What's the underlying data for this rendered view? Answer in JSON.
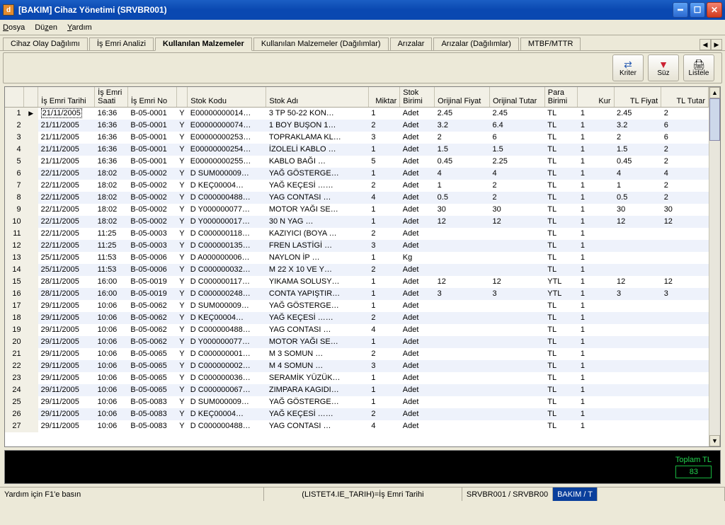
{
  "window": {
    "title": "[BAKIM] Cihaz Yönetimi (SRVBR001)"
  },
  "menu": {
    "items": [
      "Dosya",
      "Düzen",
      "Yardım"
    ]
  },
  "tabs": {
    "items": [
      "Cihaz Olay Dağılımı",
      "İş Emri Analizi",
      "Kullanılan Malzemeler",
      "Kullanılan Malzemeler (Dağılımlar)",
      "Arızalar",
      "Arızalar (Dağılımlar)",
      "MTBF/MTTR"
    ],
    "active": 2
  },
  "toolbar": {
    "kriter": "Kriter",
    "suz": "Süz",
    "listele": "Listele"
  },
  "grid": {
    "headers": [
      "İş Emri Tarihi",
      "İş Emri\nSaati",
      "İş Emri No",
      " ",
      "Stok Kodu",
      "Stok Adı",
      "Miktar",
      "Stok\nBirimi",
      "Orijinal Fiyat",
      "Orijinal Tutar",
      "Para\nBirimi",
      "Kur",
      "TL Fiyat",
      "TL Tutar"
    ],
    "rows": [
      {
        "n": 1,
        "t": "21/11/2005",
        "s": "16:36",
        "e": "B-05-0001",
        "y": "Y",
        "k": "E00000000014…",
        "a": "3 TP 50-22 KON…",
        "m": "1",
        "b": "Adet",
        "of": "2.45",
        "ot": "2.45",
        "pb": "TL",
        "kur": "1",
        "tf": "2.45",
        "tt": "2"
      },
      {
        "n": 2,
        "t": "21/11/2005",
        "s": "16:36",
        "e": "B-05-0001",
        "y": "Y",
        "k": "E00000000074…",
        "a": "1 BOY BUŞON 1…",
        "m": "2",
        "b": "Adet",
        "of": "3.2",
        "ot": "6.4",
        "pb": "TL",
        "kur": "1",
        "tf": "3.2",
        "tt": "6"
      },
      {
        "n": 3,
        "t": "21/11/2005",
        "s": "16:36",
        "e": "B-05-0001",
        "y": "Y",
        "k": "E00000000253…",
        "a": "TOPRAKLAMA KL…",
        "m": "3",
        "b": "Adet",
        "of": "2",
        "ot": "6",
        "pb": "TL",
        "kur": "1",
        "tf": "2",
        "tt": "6"
      },
      {
        "n": 4,
        "t": "21/11/2005",
        "s": "16:36",
        "e": "B-05-0001",
        "y": "Y",
        "k": "E00000000254…",
        "a": "İZOLELİ KABLO  …",
        "m": "1",
        "b": "Adet",
        "of": "1.5",
        "ot": "1.5",
        "pb": "TL",
        "kur": "1",
        "tf": "1.5",
        "tt": "2"
      },
      {
        "n": 5,
        "t": "21/11/2005",
        "s": "16:36",
        "e": "B-05-0001",
        "y": "Y",
        "k": "E00000000255…",
        "a": "KABLO BAĞI   …",
        "m": "5",
        "b": "Adet",
        "of": "0.45",
        "ot": "2.25",
        "pb": "TL",
        "kur": "1",
        "tf": "0.45",
        "tt": "2"
      },
      {
        "n": 6,
        "t": "22/11/2005",
        "s": "18:02",
        "e": "B-05-0002",
        "y": "Y",
        "k": "D SUM000009…",
        "a": "YAĞ GÖSTERGE…",
        "m": "1",
        "b": "Adet",
        "of": "4",
        "ot": "4",
        "pb": "TL",
        "kur": "1",
        "tf": "4",
        "tt": "4"
      },
      {
        "n": 7,
        "t": "22/11/2005",
        "s": "18:02",
        "e": "B-05-0002",
        "y": "Y",
        "k": "D KEÇ00004…",
        "a": "YAĞ KEÇESİ   ……",
        "m": "2",
        "b": "Adet",
        "of": "1",
        "ot": "2",
        "pb": "TL",
        "kur": "1",
        "tf": "1",
        "tt": "2"
      },
      {
        "n": 8,
        "t": "22/11/2005",
        "s": "18:02",
        "e": "B-05-0002",
        "y": "Y",
        "k": "D C000000488…",
        "a": "YAG CONTASI   …",
        "m": "4",
        "b": "Adet",
        "of": "0.5",
        "ot": "2",
        "pb": "TL",
        "kur": "1",
        "tf": "0.5",
        "tt": "2"
      },
      {
        "n": 9,
        "t": "22/11/2005",
        "s": "18:02",
        "e": "B-05-0002",
        "y": "Y",
        "k": "D Y000000077…",
        "a": "MOTOR YAĞI SE…",
        "m": "1",
        "b": "Adet",
        "of": "30",
        "ot": "30",
        "pb": "TL",
        "kur": "1",
        "tf": "30",
        "tt": "30"
      },
      {
        "n": 10,
        "t": "22/11/2005",
        "s": "18:02",
        "e": "B-05-0002",
        "y": "Y",
        "k": "D Y000000017…",
        "a": "30 N YAG      …",
        "m": "1",
        "b": "Adet",
        "of": "12",
        "ot": "12",
        "pb": "TL",
        "kur": "1",
        "tf": "12",
        "tt": "12"
      },
      {
        "n": 11,
        "t": "22/11/2005",
        "s": "11:25",
        "e": "B-05-0003",
        "y": "Y",
        "k": "D C000000118…",
        "a": "KAZIYICI (BOYA …",
        "m": "2",
        "b": "Adet",
        "of": "",
        "ot": "",
        "pb": "TL",
        "kur": "1",
        "tf": "",
        "tt": ""
      },
      {
        "n": 12,
        "t": "22/11/2005",
        "s": "11:25",
        "e": "B-05-0003",
        "y": "Y",
        "k": "D C000000135…",
        "a": "FREN LASTİGİ  …",
        "m": "3",
        "b": "Adet",
        "of": "",
        "ot": "",
        "pb": "TL",
        "kur": "1",
        "tf": "",
        "tt": ""
      },
      {
        "n": 13,
        "t": "25/11/2005",
        "s": "11:53",
        "e": "B-05-0006",
        "y": "Y",
        "k": "D A000000006…",
        "a": "NAYLON İP     …",
        "m": "1",
        "b": "Kg",
        "of": "",
        "ot": "",
        "pb": "TL",
        "kur": "1",
        "tf": "",
        "tt": ""
      },
      {
        "n": 14,
        "t": "25/11/2005",
        "s": "11:53",
        "e": "B-05-0006",
        "y": "Y",
        "k": "D C000000032…",
        "a": "M 22 X 10 VE Y…",
        "m": "2",
        "b": "Adet",
        "of": "",
        "ot": "",
        "pb": "TL",
        "kur": "1",
        "tf": "",
        "tt": ""
      },
      {
        "n": 15,
        "t": "28/11/2005",
        "s": "16:00",
        "e": "B-05-0019",
        "y": "Y",
        "k": "D C000000117…",
        "a": "YIKAMA SOLUSY…",
        "m": "1",
        "b": "Adet",
        "of": "12",
        "ot": "12",
        "pb": "YTL",
        "kur": "1",
        "tf": "12",
        "tt": "12"
      },
      {
        "n": 16,
        "t": "28/11/2005",
        "s": "16:00",
        "e": "B-05-0019",
        "y": "Y",
        "k": "D C000000248…",
        "a": "CONTA YAPIŞTIR…",
        "m": "1",
        "b": "Adet",
        "of": "3",
        "ot": "3",
        "pb": "YTL",
        "kur": "1",
        "tf": "3",
        "tt": "3"
      },
      {
        "n": 17,
        "t": "29/11/2005",
        "s": "10:06",
        "e": "B-05-0062",
        "y": "Y",
        "k": "D SUM000009…",
        "a": "YAĞ GÖSTERGE…",
        "m": "1",
        "b": "Adet",
        "of": "",
        "ot": "",
        "pb": "TL",
        "kur": "1",
        "tf": "",
        "tt": ""
      },
      {
        "n": 18,
        "t": "29/11/2005",
        "s": "10:06",
        "e": "B-05-0062",
        "y": "Y",
        "k": "D KEÇ00004…",
        "a": "YAĞ KEÇESİ   ……",
        "m": "2",
        "b": "Adet",
        "of": "",
        "ot": "",
        "pb": "TL",
        "kur": "1",
        "tf": "",
        "tt": ""
      },
      {
        "n": 19,
        "t": "29/11/2005",
        "s": "10:06",
        "e": "B-05-0062",
        "y": "Y",
        "k": "D C000000488…",
        "a": "YAG CONTASI   …",
        "m": "4",
        "b": "Adet",
        "of": "",
        "ot": "",
        "pb": "TL",
        "kur": "1",
        "tf": "",
        "tt": ""
      },
      {
        "n": 20,
        "t": "29/11/2005",
        "s": "10:06",
        "e": "B-05-0062",
        "y": "Y",
        "k": "D Y000000077…",
        "a": "MOTOR YAĞI SE…",
        "m": "1",
        "b": "Adet",
        "of": "",
        "ot": "",
        "pb": "TL",
        "kur": "1",
        "tf": "",
        "tt": ""
      },
      {
        "n": 21,
        "t": "29/11/2005",
        "s": "10:06",
        "e": "B-05-0065",
        "y": "Y",
        "k": "D C000000001…",
        "a": "M 3 SOMUN     …",
        "m": "2",
        "b": "Adet",
        "of": "",
        "ot": "",
        "pb": "TL",
        "kur": "1",
        "tf": "",
        "tt": ""
      },
      {
        "n": 22,
        "t": "29/11/2005",
        "s": "10:06",
        "e": "B-05-0065",
        "y": "Y",
        "k": "D C000000002…",
        "a": "M 4 SOMUN     …",
        "m": "3",
        "b": "Adet",
        "of": "",
        "ot": "",
        "pb": "TL",
        "kur": "1",
        "tf": "",
        "tt": ""
      },
      {
        "n": 23,
        "t": "29/11/2005",
        "s": "10:06",
        "e": "B-05-0065",
        "y": "Y",
        "k": "D C000000036…",
        "a": "SERAMİK YÜZÜK…",
        "m": "1",
        "b": "Adet",
        "of": "",
        "ot": "",
        "pb": "TL",
        "kur": "1",
        "tf": "",
        "tt": ""
      },
      {
        "n": 24,
        "t": "29/11/2005",
        "s": "10:06",
        "e": "B-05-0065",
        "y": "Y",
        "k": "D C000000067…",
        "a": "ZIMPARA KAGIDI…",
        "m": "1",
        "b": "Adet",
        "of": "",
        "ot": "",
        "pb": "TL",
        "kur": "1",
        "tf": "",
        "tt": ""
      },
      {
        "n": 25,
        "t": "29/11/2005",
        "s": "10:06",
        "e": "B-05-0083",
        "y": "Y",
        "k": "D SUM000009…",
        "a": "YAĞ GÖSTERGE…",
        "m": "1",
        "b": "Adet",
        "of": "",
        "ot": "",
        "pb": "TL",
        "kur": "1",
        "tf": "",
        "tt": ""
      },
      {
        "n": 26,
        "t": "29/11/2005",
        "s": "10:06",
        "e": "B-05-0083",
        "y": "Y",
        "k": "D KEÇ00004…",
        "a": "YAĞ KEÇESİ   ……",
        "m": "2",
        "b": "Adet",
        "of": "",
        "ot": "",
        "pb": "TL",
        "kur": "1",
        "tf": "",
        "tt": ""
      },
      {
        "n": 27,
        "t": "29/11/2005",
        "s": "10:06",
        "e": "B-05-0083",
        "y": "Y",
        "k": "D C000000488…",
        "a": "YAG CONTASI   …",
        "m": "4",
        "b": "Adet",
        "of": "",
        "ot": "",
        "pb": "TL",
        "kur": "1",
        "tf": "",
        "tt": ""
      }
    ]
  },
  "total": {
    "label": "Toplam TL",
    "value": "83"
  },
  "status": {
    "help": "Yardım için F1'e basın",
    "mid": "(LISTET4.IE_TARIH)=İş Emri Tarihi",
    "srv": "SRVBR001 / SRVBR00",
    "ctx": "BAKIM / T"
  }
}
